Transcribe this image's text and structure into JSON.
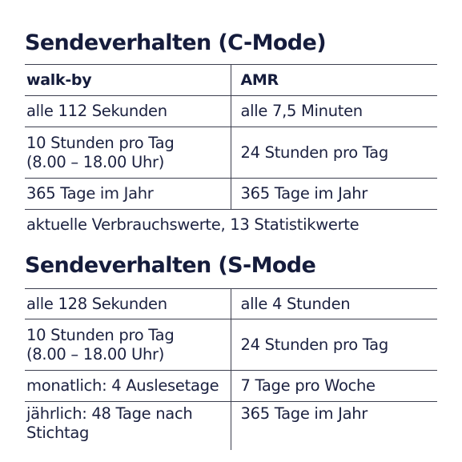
{
  "section1": {
    "title": "Sendeverhalten (C-Mode)",
    "header": [
      "walk-by",
      "AMR"
    ],
    "rows": [
      [
        "alle 112 Sekunden",
        "alle 7,5 Minuten"
      ],
      [
        "10 Stunden pro Tag\n(8.00 – 18.00 Uhr)",
        "24 Stunden pro Tag"
      ],
      [
        "365 Tage im Jahr",
        "365 Tage im Jahr"
      ]
    ],
    "footer": "aktuelle Verbrauchswerte, 13 Statistikwerte"
  },
  "section2": {
    "title": "Sendeverhalten (S-Mode",
    "rows": [
      [
        "alle 128 Sekunden",
        "alle 4 Stunden"
      ],
      [
        "10 Stunden pro Tag\n(8.00 – 18.00 Uhr)",
        "24 Stunden pro Tag"
      ],
      [
        "monatlich: 4 Auslesetage",
        "7 Tage pro Woche"
      ],
      [
        "jährlich: 48 Tage nach\nStichtag",
        "365 Tage im Jahr"
      ]
    ]
  }
}
